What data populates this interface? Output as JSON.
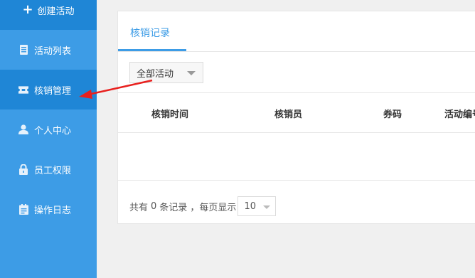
{
  "sidebar": {
    "create": {
      "label": "创建活动",
      "icon": "plus-icon"
    },
    "items": [
      {
        "label": "活动列表",
        "icon": "list-icon"
      },
      {
        "label": "核销管理",
        "icon": "ticket-icon",
        "active": true
      },
      {
        "label": "个人中心",
        "icon": "user-icon"
      },
      {
        "label": "员工权限",
        "icon": "lock-icon"
      },
      {
        "label": "操作日志",
        "icon": "log-icon"
      }
    ]
  },
  "main": {
    "tab": "核销记录",
    "filter": {
      "selected": "全部活动"
    },
    "table": {
      "headers": [
        "核销时间",
        "核销员",
        "券码",
        "活动编号"
      ],
      "rows": []
    },
    "footer": {
      "prefix": "共有",
      "count": "0",
      "suffix": "条记录 ，每页显示",
      "page_size": "10"
    }
  },
  "colors": {
    "sidebar": "#3d9ce6",
    "sidebar_active": "#1f86d6",
    "accent": "#3d9ce6",
    "annotation_arrow": "#e8201e"
  }
}
